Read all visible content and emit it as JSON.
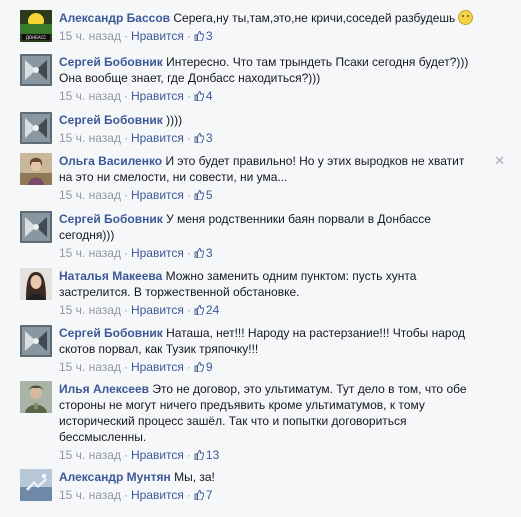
{
  "comments": [
    {
      "author": "Александр Бассов",
      "text": " Серега,ну ты,там,это,не кричи,соседей разбудешь",
      "time": "15 ч. назад",
      "like": "Нравится",
      "likes": "3",
      "avatar": "avatar-bassov-icon",
      "smiley": true
    },
    {
      "author": "Сергей Бобовник",
      "text": " Интересно. Что там трындеть Псаки сегодня будет?))) Она вообще знает, где Донбасс находиться?)))",
      "time": "15 ч. назад",
      "like": "Нравится",
      "likes": "4",
      "avatar": "avatar-bobovnik-icon"
    },
    {
      "author": "Сергей Бобовник",
      "text": " ))))",
      "time": "15 ч. назад",
      "like": "Нравится",
      "likes": "3",
      "avatar": "avatar-bobovnik-icon"
    },
    {
      "author": "Ольга Василенко",
      "text": " И это будет правильно! Но у этих выродков не хватит на это ни смелости, ни совести, ни ума...",
      "time": "15 ч. назад",
      "like": "Нравится",
      "likes": "5",
      "avatar": "avatar-vasilenko-icon",
      "close": "✕"
    },
    {
      "author": "Сергей Бобовник",
      "text": " У меня родственники баян порвали в Донбассе сегодня)))",
      "time": "15 ч. назад",
      "like": "Нравится",
      "likes": "3",
      "avatar": "avatar-bobovnik-icon"
    },
    {
      "author": "Наталья Макеева",
      "text": " Можно заменить одним пунктом: пусть хунта застрелится. В торжественной обстановке.",
      "time": "15 ч. назад",
      "like": "Нравится",
      "likes": "24",
      "avatar": "avatar-makeeva-icon"
    },
    {
      "author": "Сергей Бобовник",
      "text": " Наташа, нет!!! Народу на растерзание!!! Чтобы народ скотов порвал, как Тузик тряпочку!!!",
      "time": "15 ч. назад",
      "like": "Нравится",
      "likes": "9",
      "avatar": "avatar-bobovnik-icon"
    },
    {
      "author": "Илья Алексеев",
      "text": " Это не договор, это ультиматум. Тут дело в том, что обе стороны не могут ничего предъявить кроме ультиматумов, к тому исторический процесс зашёл. Так что и попытки договориться бессмысленны.",
      "time": "15 ч. назад",
      "like": "Нравится",
      "likes": "13",
      "avatar": "avatar-alekseev-icon"
    },
    {
      "author": "Александр Мунтян",
      "text": " Мы, за!",
      "time": "15 ч. назад",
      "like": "Нравится",
      "likes": "7",
      "avatar": "avatar-muntyan-icon"
    }
  ],
  "colors": {
    "link": "#3b5998",
    "meta": "#9197a3",
    "background": "#f6f7f9"
  }
}
